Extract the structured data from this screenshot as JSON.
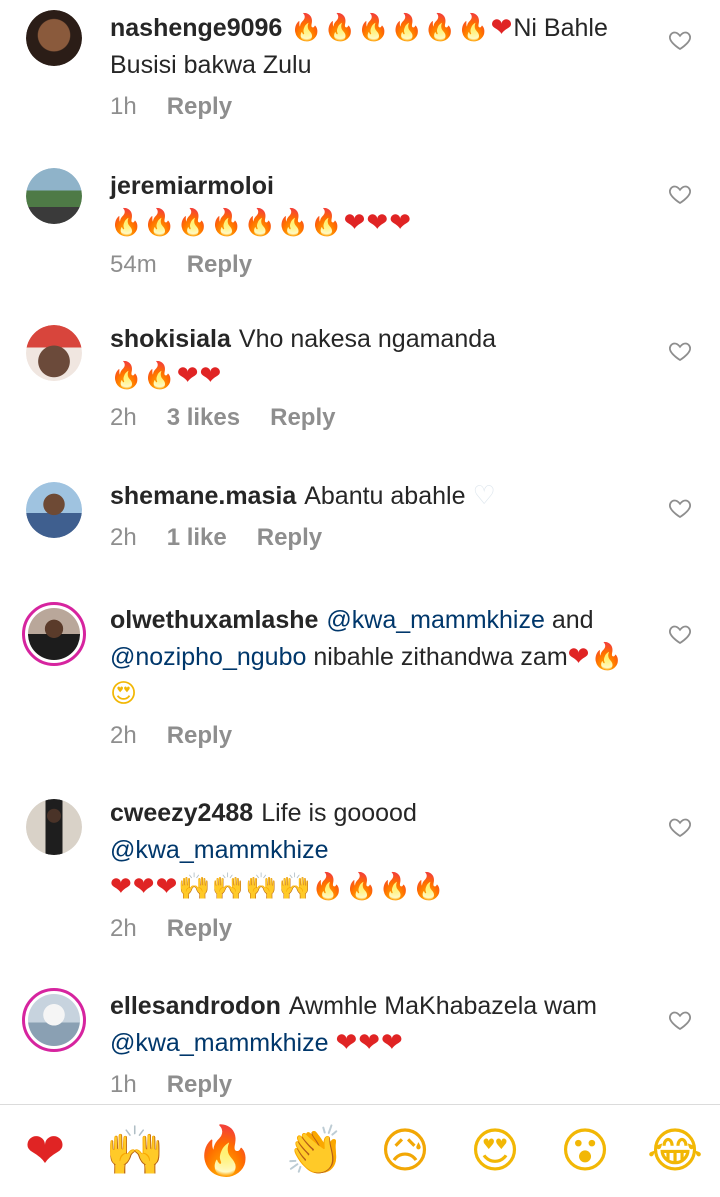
{
  "comments": [
    {
      "username": "nashenge9096",
      "pre": "",
      "emoji_a": "🔥🔥🔥🔥🔥🔥",
      "emoji_b": "❤",
      "text": "Ni Bahle Busisi bakwa Zulu",
      "time": "1h",
      "likes": "",
      "reply": "Reply",
      "avatar_color": "#3b2a22",
      "ring": false
    },
    {
      "username": "jeremiarmoloi",
      "emoji_a": "🔥🔥🔥🔥🔥🔥🔥",
      "emoji_b": "❤❤❤",
      "time": "54m",
      "likes": "",
      "reply": "Reply",
      "avatar_color": "#6f8fa0",
      "ring": false
    },
    {
      "username": "shokisiala",
      "text": "Vho nakesa ngamanda",
      "emoji_a": "🔥🔥",
      "emoji_b": "❤❤",
      "time": "2h",
      "likes": "3 likes",
      "reply": "Reply",
      "avatar_color": "#c9483e",
      "ring": false
    },
    {
      "username": "shemane.masia",
      "text": "Abantu abahle",
      "emoji_b": "♡",
      "time": "2h",
      "likes": "1 like",
      "reply": "Reply",
      "avatar_color": "#4e6f9a",
      "ring": false
    },
    {
      "username": "olwethuxamlashe",
      "mention1": "@kwa_mammkhize",
      "mid": "and",
      "mention2": "@nozipho_ngubo",
      "text": "nibahle zithandwa zam",
      "emoji_b": "❤",
      "emoji_a": "🔥",
      "emoji_c": "😍",
      "time": "2h",
      "likes": "",
      "reply": "Reply",
      "avatar_color": "#3d3733",
      "ring": true
    },
    {
      "username": "cweezy2488",
      "text": "Life is gooood",
      "mention1": "@kwa_mammkhize",
      "emoji_b": "❤❤❤",
      "emoji_d": "🙌🙌🙌🙌",
      "emoji_a": "🔥🔥🔥🔥",
      "time": "2h",
      "likes": "",
      "reply": "Reply",
      "avatar_color": "#c9c2b8",
      "ring": false
    },
    {
      "username": "ellesandrodon",
      "text": "Awmhle MaKhabazela wam",
      "mention1": "@kwa_mammkhize",
      "emoji_b": "❤❤❤",
      "time": "1h",
      "likes": "",
      "reply": "Reply",
      "avatar_color": "#d8dee5",
      "ring": true
    }
  ],
  "reactions": [
    {
      "name": "heart",
      "emoji": "❤",
      "color": "#e02424"
    },
    {
      "name": "raising-hands",
      "emoji": "🙌",
      "color": "#f2b705"
    },
    {
      "name": "fire",
      "emoji": "🔥",
      "color": "#ff6a00"
    },
    {
      "name": "clapping",
      "emoji": "👏",
      "color": "#f2b705"
    },
    {
      "name": "sad-face",
      "emoji": "😥",
      "color": "#f2a705"
    },
    {
      "name": "heart-eyes",
      "emoji": "😍",
      "color": "#f2b705"
    },
    {
      "name": "surprised-face",
      "emoji": "😮",
      "color": "#f2b705"
    },
    {
      "name": "tears-of-joy",
      "emoji": "😂",
      "color": "#f2b705"
    }
  ]
}
